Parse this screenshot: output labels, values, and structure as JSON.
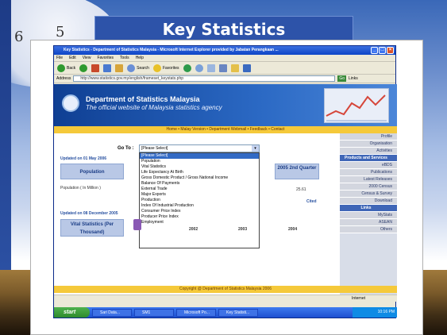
{
  "slide": {
    "title": "Key Statistics",
    "clock_numbers": [
      "6",
      "5"
    ]
  },
  "window": {
    "title_bar": "Key Statistics - Department of Statistics Malaysia - Microsoft Internet Explorer provided by Jabatan Perangkaan ...",
    "menu": [
      "File",
      "Edit",
      "View",
      "Favorites",
      "Tools",
      "Help"
    ],
    "toolbar": {
      "back": "Back",
      "search": "Search",
      "favorites": "Favorites"
    },
    "address_label": "Address",
    "address_value": "http://www.statistics.gov.my/english/frameset_keystats.php",
    "go_label": "Go",
    "links_label": "Links"
  },
  "page": {
    "dept_title": "Department of Statistics Malaysia",
    "dept_subtitle": "The official website of Malaysia statistics agency",
    "nav_links": "Home • Malay Version • Department Webmail • Feedback • Contact",
    "goto_label": "Go To :",
    "select_value": "[Please Select]",
    "dropdown_options": [
      "[Please Select]",
      "Population",
      "Vital Statistics",
      "Life Expectancy At Birth",
      "Gross Domestic Product / Gross National Income",
      "Balance Of Payments",
      "External Trade",
      "Major Exports",
      "Production",
      "Index Of Industrial Production",
      "Consumer Price Index",
      "Producer Price Index",
      "Employment"
    ],
    "updated_1": "Updated on 01 May 2006",
    "population_header": "Population",
    "quarter_header": "2005 2nd Quarter",
    "population_row": "Population ( In Million )",
    "population_value": "25.61",
    "cited_label": "Cited",
    "updated_2": "Updated on 08 December 2005",
    "vital_header": "Vital Statistics (Per Thousand)",
    "year_a": "2002",
    "year_b": "2003",
    "year_c": "2004",
    "copyright": "Copyright @ Department of Statistics Malaysia 2006",
    "right_panel": [
      {
        "label": "Profile",
        "head": false
      },
      {
        "label": "Organisation",
        "head": false
      },
      {
        "label": "Activities",
        "head": false
      },
      {
        "label": "Products and Services",
        "head": true
      },
      {
        "label": "eBDS",
        "head": false
      },
      {
        "label": "Publications",
        "head": false
      },
      {
        "label": "Latest Releases",
        "head": false
      },
      {
        "label": "2000 Census",
        "head": false
      },
      {
        "label": "Census & Survey",
        "head": false
      },
      {
        "label": "Download",
        "head": false
      },
      {
        "label": "Links",
        "head": true
      },
      {
        "label": "MyStats",
        "head": false
      },
      {
        "label": "ASEAN",
        "head": false
      },
      {
        "label": "Others",
        "head": false
      }
    ]
  },
  "status": {
    "left": "",
    "zone": "Internet"
  },
  "taskbar": {
    "start": "start",
    "tasks": [
      "Sari Data...",
      "SM1",
      "Microsoft Po...",
      "Key Statisti..."
    ],
    "clock": "10:16 PM"
  }
}
